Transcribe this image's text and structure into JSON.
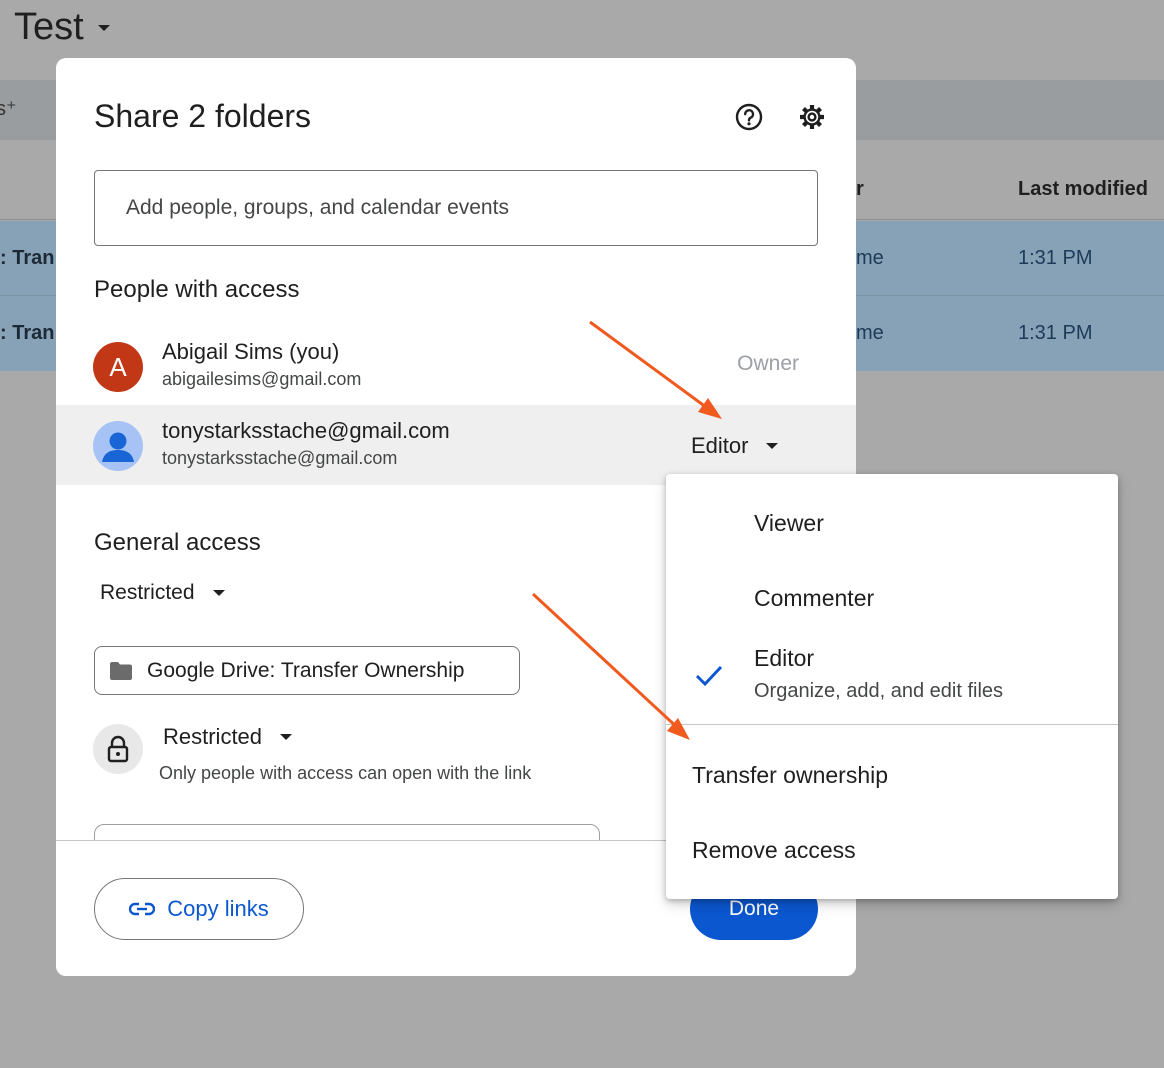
{
  "background": {
    "title": "Test",
    "columns": {
      "owner_partial": "r",
      "last_modified": "Last modified"
    },
    "rows": [
      {
        "name_partial": ": Tran",
        "owner_partial": "me",
        "modified": "1:31 PM"
      },
      {
        "name_partial": ": Tran",
        "owner_partial": "me",
        "modified": "1:31 PM"
      }
    ]
  },
  "dialog": {
    "title": "Share 2 folders",
    "add_placeholder": "Add people, groups, and calendar events",
    "people_heading": "People with access",
    "people": [
      {
        "initial": "A",
        "name": "Abigail Sims (you)",
        "email": "abigailesims@gmail.com",
        "role": "Owner"
      },
      {
        "name": "tonystarksstache@gmail.com",
        "email": "tonystarksstache@gmail.com",
        "role": "Editor"
      }
    ],
    "general_heading": "General access",
    "general_value": "Restricted",
    "folder_chip": "Google Drive: Transfer Ownership",
    "link_access": "Restricted",
    "link_desc": "Only people with access can open with the link",
    "copy_links": "Copy links",
    "done": "Done"
  },
  "menu": {
    "viewer": "Viewer",
    "commenter": "Commenter",
    "editor": "Editor",
    "editor_desc": "Organize, add, and edit files",
    "transfer": "Transfer ownership",
    "remove": "Remove access"
  },
  "colors": {
    "accent": "#0b57d0",
    "avatar": "#c23816",
    "arrow": "#f05a1e",
    "overlay": "#a9a9a9",
    "selected_row": "#87a2b6"
  },
  "icons": [
    "help-icon",
    "gear-icon",
    "caret-down-icon",
    "person-icon",
    "folder-icon",
    "lock-icon",
    "link-icon",
    "check-icon",
    "arrow-icon"
  ]
}
